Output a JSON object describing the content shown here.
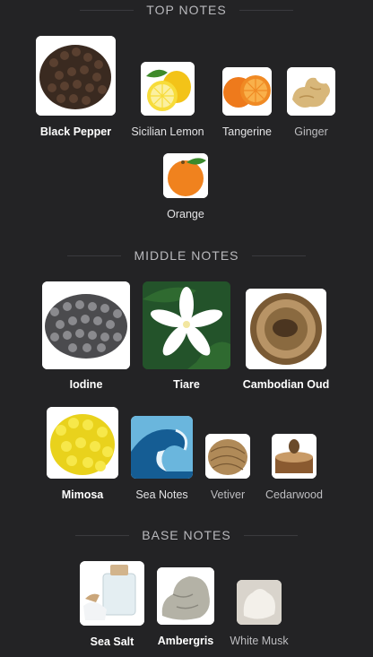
{
  "sections": {
    "top": {
      "title": "TOP NOTES"
    },
    "middle": {
      "title": "MIDDLE NOTES"
    },
    "base": {
      "title": "BASE NOTES"
    }
  },
  "notes": {
    "black_pepper": {
      "label": "Black Pepper",
      "icon": "black-pepper-icon"
    },
    "sicilian_lemon": {
      "label": "Sicilian Lemon",
      "icon": "lemon-icon"
    },
    "tangerine": {
      "label": "Tangerine",
      "icon": "tangerine-icon"
    },
    "ginger": {
      "label": "Ginger",
      "icon": "ginger-icon"
    },
    "orange": {
      "label": "Orange",
      "icon": "orange-icon"
    },
    "iodine": {
      "label": "Iodine",
      "icon": "iodine-icon"
    },
    "tiare": {
      "label": "Tiare",
      "icon": "tiare-flower-icon"
    },
    "cambodian_oud": {
      "label": "Cambodian Oud",
      "icon": "oud-wood-icon"
    },
    "mimosa": {
      "label": "Mimosa",
      "icon": "mimosa-icon"
    },
    "sea_notes": {
      "label": "Sea Notes",
      "icon": "wave-icon"
    },
    "vetiver": {
      "label": "Vetiver",
      "icon": "vetiver-icon"
    },
    "cedarwood": {
      "label": "Cedarwood",
      "icon": "cedarwood-icon"
    },
    "sea_salt": {
      "label": "Sea Salt",
      "icon": "sea-salt-icon"
    },
    "ambergris": {
      "label": "Ambergris",
      "icon": "ambergris-icon"
    },
    "white_musk": {
      "label": "White Musk",
      "icon": "white-musk-icon"
    }
  },
  "colors": {
    "background": "#232325",
    "section_title": "#b9b9bd"
  }
}
